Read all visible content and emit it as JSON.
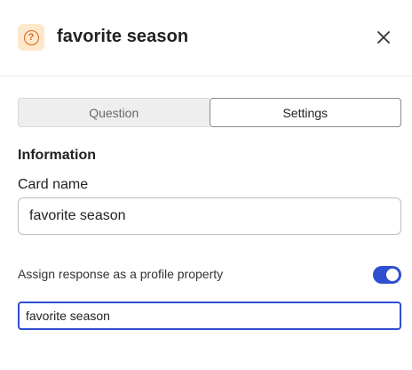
{
  "header": {
    "title": "favorite season",
    "icon": "question-circle-icon",
    "icon_color": "#d2691e",
    "icon_bg": "#fde8cc",
    "close_icon": "close-icon"
  },
  "tabs": [
    {
      "label": "Question",
      "active": false
    },
    {
      "label": "Settings",
      "active": true
    }
  ],
  "information": {
    "heading": "Information",
    "card_name_label": "Card name",
    "card_name_value": "favorite season"
  },
  "profile_property": {
    "label": "Assign response as a profile property",
    "toggle_on": true,
    "value": "favorite season"
  },
  "colors": {
    "accent": "#2f4fd1"
  }
}
